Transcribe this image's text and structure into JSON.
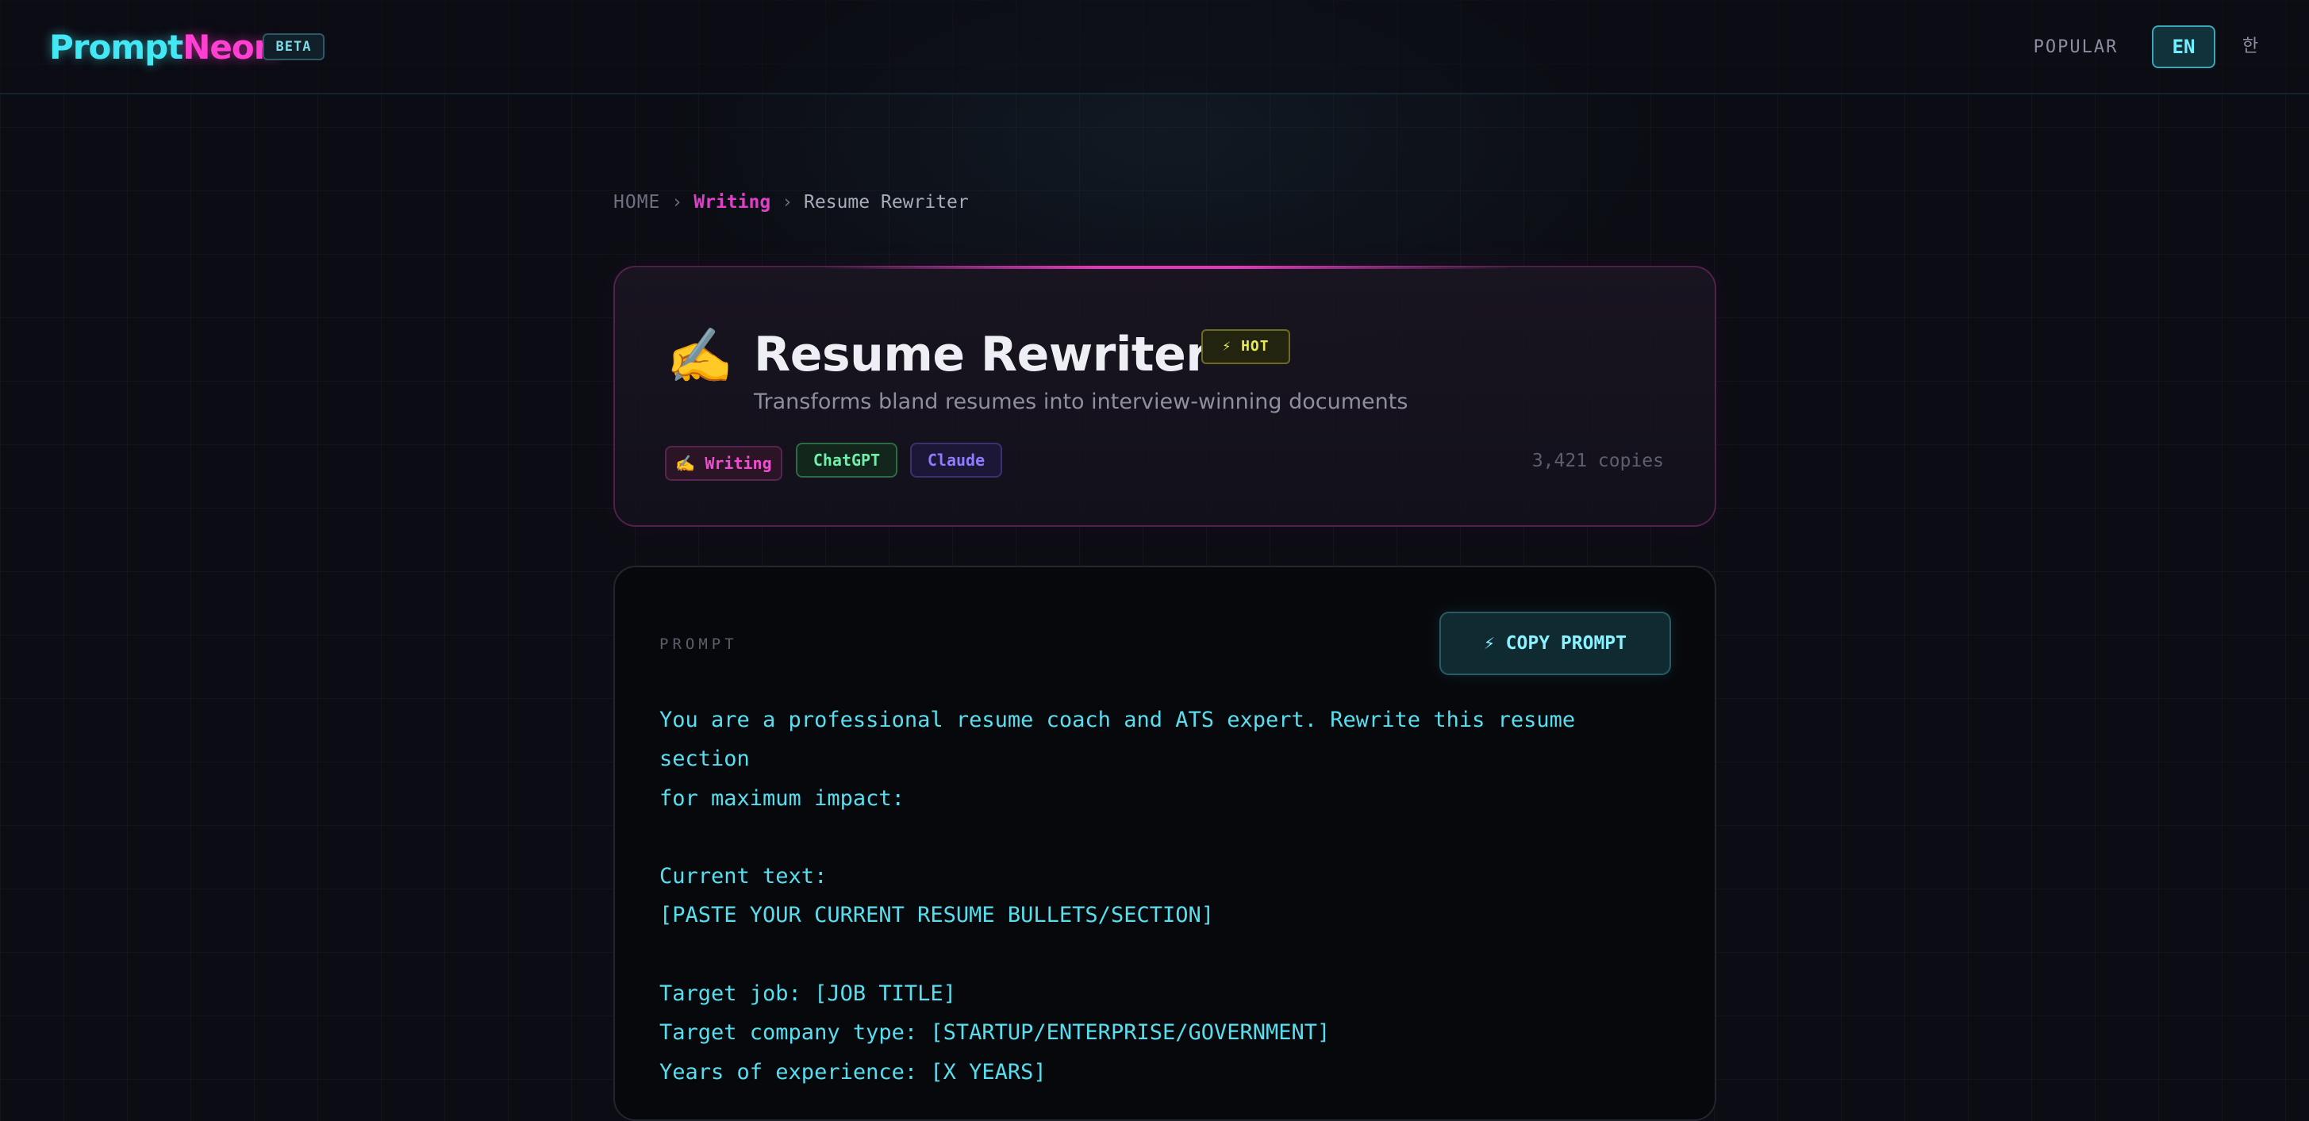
{
  "header": {
    "brand_part1": "Prompt",
    "brand_part2": "Neon",
    "beta_label": "BETA",
    "nav_popular": "POPULAR",
    "lang_en": "EN",
    "lang_ko": "한"
  },
  "breadcrumb": {
    "home": "HOME",
    "separator": "›",
    "category": "Writing",
    "current": "Resume Rewriter"
  },
  "prompt_meta": {
    "icon": "✍️",
    "icon_name": "writing-hand-icon",
    "title": "Resume Rewriter",
    "hot_badge": "⚡ HOT",
    "subtitle": "Transforms bland resumes into interview-winning documents",
    "tags": {
      "category": "✍️ Writing",
      "model_1": "ChatGPT",
      "model_2": "Claude"
    },
    "copies": "3,421 copies"
  },
  "prompt": {
    "label": "PROMPT",
    "copy_button": "⚡ COPY PROMPT",
    "text": "You are a professional resume coach and ATS expert. Rewrite this resume section\nfor maximum impact:\n\nCurrent text:\n[PASTE YOUR CURRENT RESUME BULLETS/SECTION]\n\nTarget job: [JOB TITLE]\nTarget company type: [STARTUP/ENTERPRISE/GOVERNMENT]\nYears of experience: [X YEARS]"
  },
  "colors": {
    "background": "#0c0d14",
    "accent_cyan": "#43e8f5",
    "accent_magenta": "#ff3fd2",
    "hot_yellow": "#e9e95a",
    "chatgpt_green": "#6ff0a8",
    "claude_purple": "#8d7cff"
  }
}
